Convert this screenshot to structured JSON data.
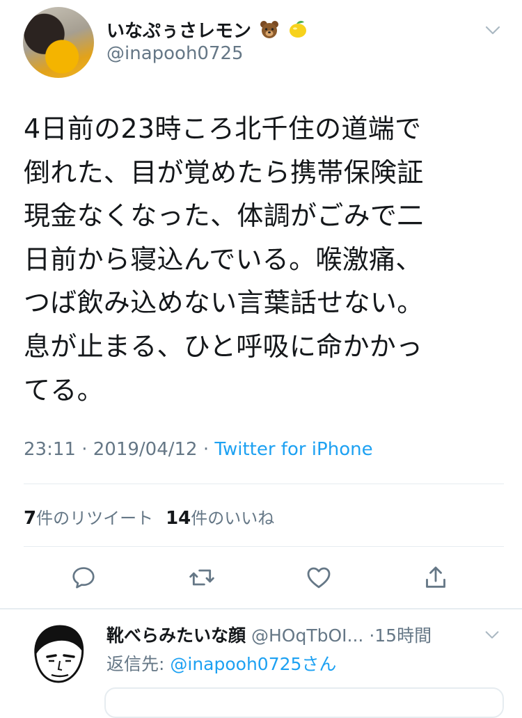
{
  "tweet": {
    "author": {
      "display_name": "いなぷぅさレモン",
      "name_emojis": [
        "bear-emoji",
        "lemon-emoji"
      ],
      "handle": "@inapooh0725"
    },
    "text_lines": [
      "4日前の23時ころ北千住の道端で",
      "倒れた、目が覚めたら携帯保険証",
      "現金なくなった、体調がごみで二",
      "日前から寝込んでいる。喉激痛、",
      "つば飲み込めない言葉話せない。",
      "息が止まる、ひと呼吸に命かかっ",
      "てる。"
    ],
    "time": "23:11",
    "date": "2019/04/12",
    "meta_separator": "·",
    "source": "Twitter for iPhone",
    "retweets": {
      "count": "7",
      "label": "件のリツイート"
    },
    "likes": {
      "count": "14",
      "label": "件のいいね"
    },
    "actions": [
      "reply-icon",
      "retweet-icon",
      "like-icon",
      "share-icon"
    ],
    "colors": {
      "text": "#14171a",
      "secondary": "#657786",
      "link": "#1da1f2",
      "divider": "#e6ecf0"
    }
  },
  "reply": {
    "display_name": "靴べらみたいな顔",
    "handle": "@HOqTbOI...",
    "separator": "·",
    "time": "15時間",
    "reply_to_label": "返信先:",
    "reply_to_mention": "@inapooh0725さん"
  }
}
